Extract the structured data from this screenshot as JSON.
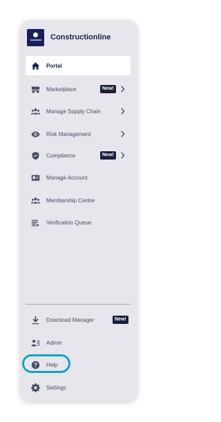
{
  "brand": {
    "name": "Constructionline"
  },
  "nav": {
    "portal": "Portal",
    "marketplace": "Marketplace",
    "marketplace_badge": "New!",
    "supply_chain": "Manage Supply Chain",
    "risk": "Risk Management",
    "compliance": "Compliance",
    "compliance_badge": "New!",
    "account": "Manage Account",
    "membership": "Membership Centre",
    "verification": "Verification Queue"
  },
  "footer": {
    "download": "Download Manager",
    "download_badge": "New!",
    "admin": "Admin",
    "help": "Help",
    "settings": "Settings"
  },
  "colors": {
    "panel": "#e6e6ec",
    "brand_navy": "#1c2148",
    "badge_bg": "#1c1f3a",
    "highlight": "#10a5c6"
  }
}
